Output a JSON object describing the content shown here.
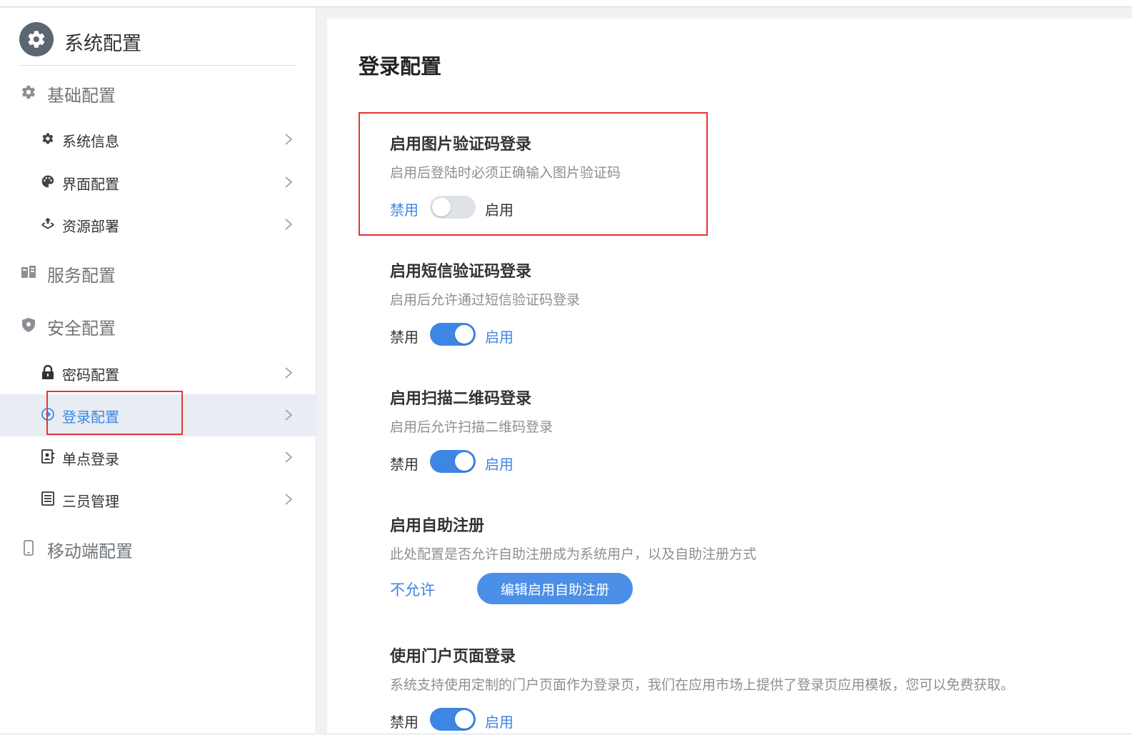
{
  "sidebar": {
    "title": "系统配置",
    "groups": [
      {
        "label": "基础配置",
        "icon": "gear-icon"
      },
      {
        "label": "服务配置",
        "icon": "server-icon"
      },
      {
        "label": "安全配置",
        "icon": "shield-icon"
      },
      {
        "label": "移动端配置",
        "icon": "mobile-icon"
      }
    ],
    "items": [
      {
        "label": "系统信息",
        "icon": "gear-icon"
      },
      {
        "label": "界面配置",
        "icon": "palette-icon"
      },
      {
        "label": "资源部署",
        "icon": "upload-icon"
      },
      {
        "label": "密码配置",
        "icon": "lock-icon"
      },
      {
        "label": "登录配置",
        "icon": "login-icon",
        "active": true
      },
      {
        "label": "单点登录",
        "icon": "id-card-icon"
      },
      {
        "label": "三员管理",
        "icon": "list-icon"
      }
    ]
  },
  "main": {
    "title": "登录配置",
    "sections": [
      {
        "title": "启用图片验证码登录",
        "desc": "启用后登陆时必须正确输入图片验证码",
        "off_label": "禁用",
        "on_label": "启用",
        "enabled": false
      },
      {
        "title": "启用短信验证码登录",
        "desc": "启用后允许通过短信验证码登录",
        "off_label": "禁用",
        "on_label": "启用",
        "enabled": true
      },
      {
        "title": "启用扫描二维码登录",
        "desc": "启用后允许扫描二维码登录",
        "off_label": "禁用",
        "on_label": "启用",
        "enabled": true
      },
      {
        "title": "启用自助注册",
        "desc": "此处配置是否允许自助注册成为系统用户，以及自助注册方式",
        "status": "不允许",
        "button": "编辑启用自助注册"
      },
      {
        "title": "使用门户页面登录",
        "desc": "系统支持使用定制的门户页面作为登录页，我们在应用市场上提供了登录页应用模板，您可以免费获取。",
        "off_label": "禁用",
        "on_label": "启用",
        "enabled": true
      }
    ]
  },
  "colors": {
    "accent": "#3d86e4",
    "highlight_border": "#e53434",
    "active_bg": "#e8edf4"
  }
}
